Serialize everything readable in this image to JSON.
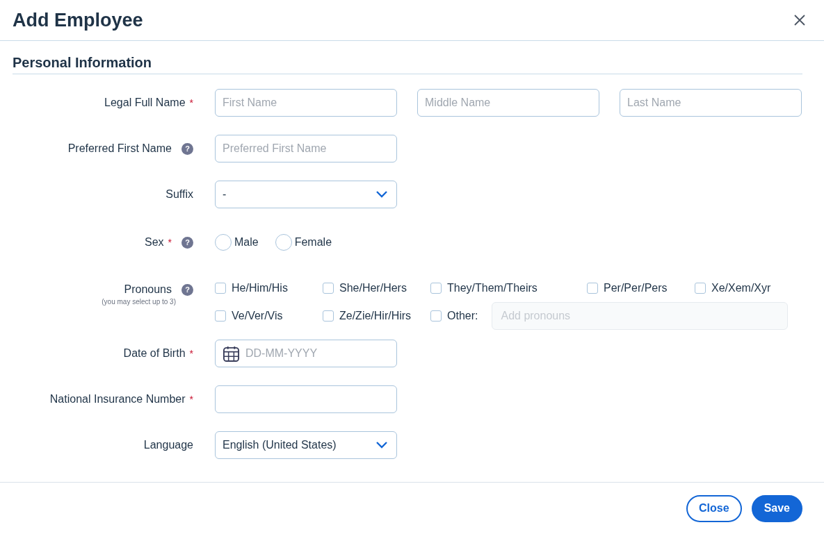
{
  "dialog": {
    "title": "Add Employee"
  },
  "section": {
    "title": "Personal Information"
  },
  "rows": [
    {
      "kind": "names",
      "label": "Legal Full Name",
      "required_mark": "*",
      "inputs": [
        {
          "placeholder": "First Name"
        },
        {
          "placeholder": "Middle Name"
        },
        {
          "placeholder": "Last Name"
        }
      ]
    },
    {
      "kind": "names",
      "label": "Preferred First Name",
      "help_icon": "?",
      "inputs": [
        {
          "placeholder": "Preferred First Name"
        }
      ]
    },
    {
      "kind": "select",
      "label": "Suffix",
      "value": "-"
    },
    {
      "kind": "radios",
      "label": "Sex",
      "required_mark": "*",
      "help_icon": "?",
      "options": [
        {
          "label": "Male",
          "selected": false
        },
        {
          "label": "Female",
          "selected": false
        }
      ]
    },
    {
      "kind": "checkboxes",
      "label": "Pronouns",
      "hint": "(you may select up to 3)",
      "help_icon": "?",
      "options": [
        {
          "label": "He/Him/His",
          "checked": false
        },
        {
          "label": "She/Her/Hers",
          "checked": false
        },
        {
          "label": "They/Them/Theirs",
          "checked": false
        },
        {
          "label": "Per/Per/Pers",
          "checked": false
        },
        {
          "label": "Xe/Xem/Xyr",
          "checked": false
        },
        {
          "label": "Ve/Ver/Vis",
          "checked": false
        },
        {
          "label": "Ze/Zie/Hir/Hirs",
          "checked": false
        },
        {
          "label": "Other:",
          "checked": false,
          "other_placeholder": "Add pronouns"
        }
      ]
    },
    {
      "kind": "date",
      "label": "Date of Birth",
      "required_mark": "*",
      "placeholder": "DD-MM-YYYY"
    },
    {
      "kind": "blank_input",
      "label": "National Insurance Number",
      "required_mark": "*"
    },
    {
      "kind": "select",
      "label": "Language",
      "value": "English (United States)"
    }
  ],
  "buttons": [
    {
      "label": "Close",
      "kind": "secondary"
    },
    {
      "label": "Save",
      "kind": "primary"
    }
  ]
}
